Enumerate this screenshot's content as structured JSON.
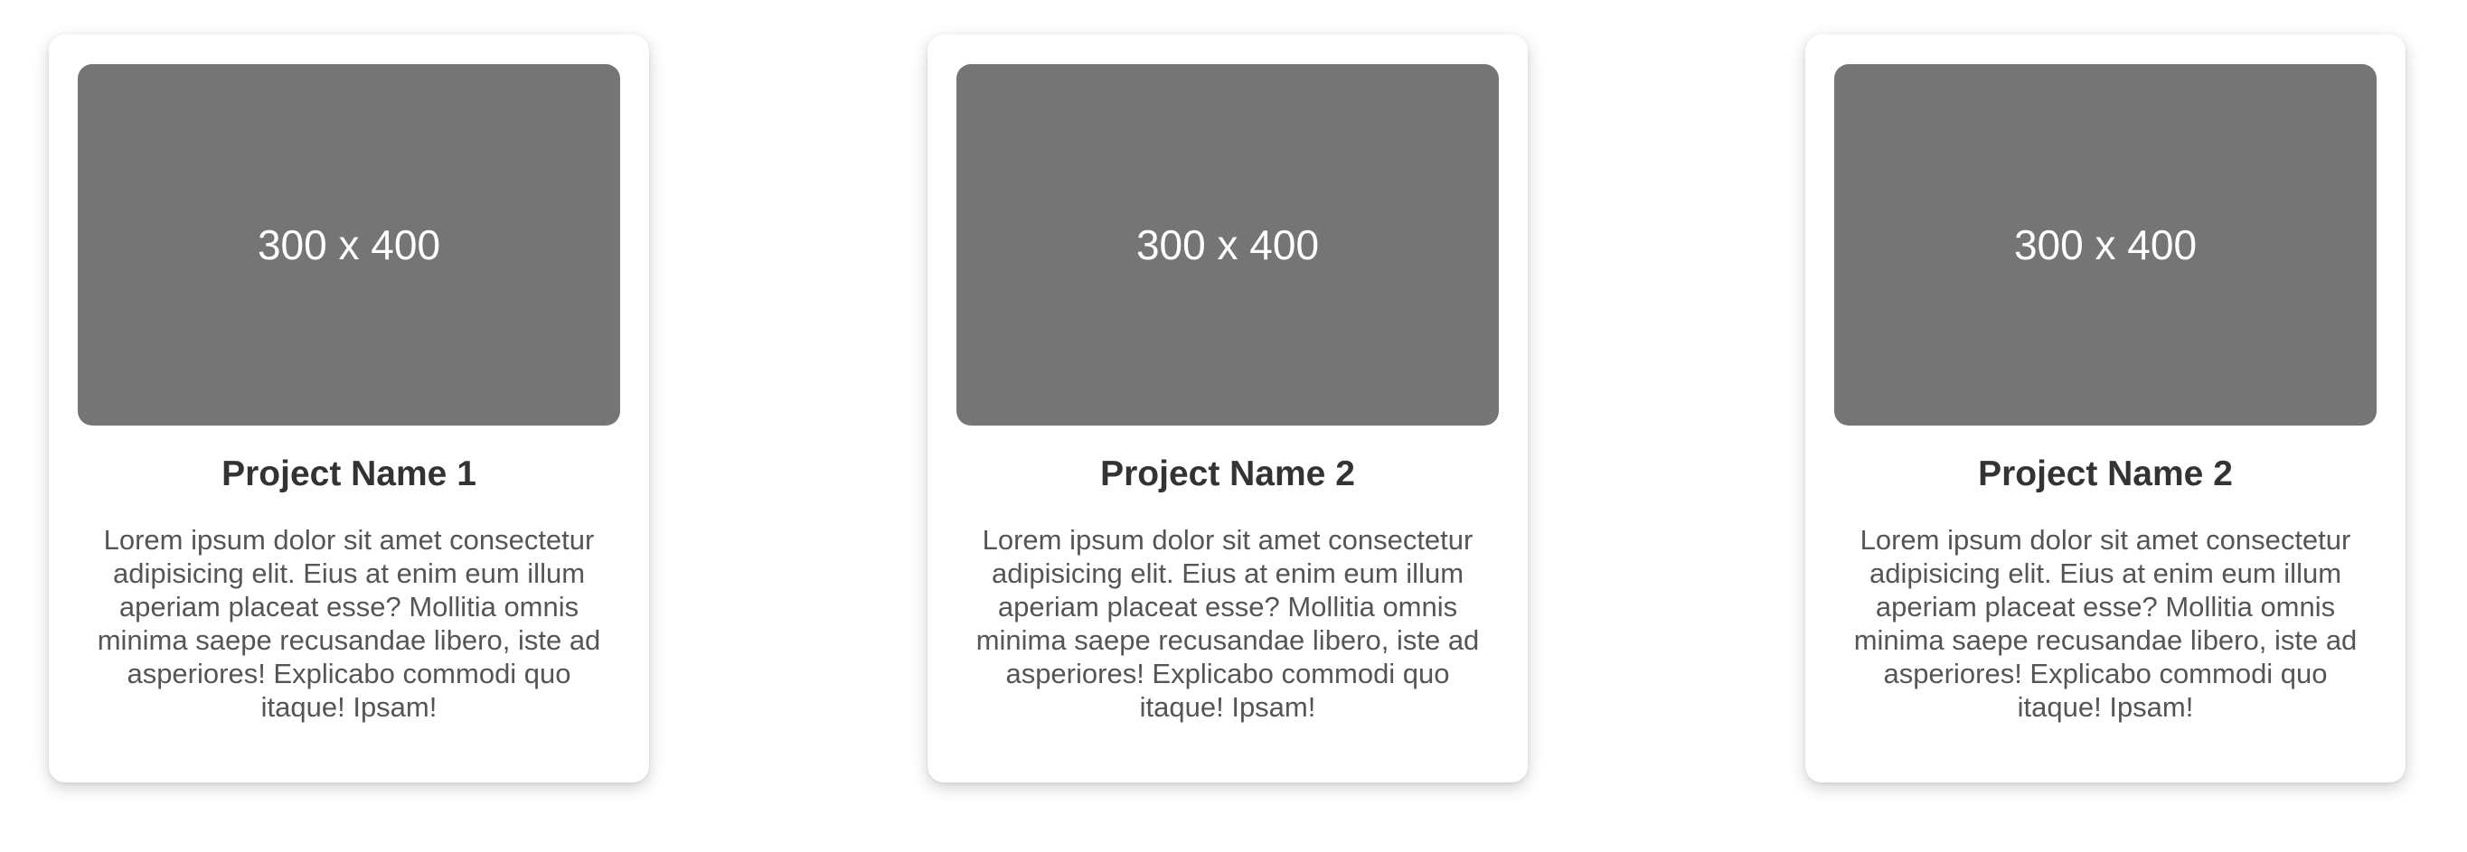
{
  "cards": [
    {
      "image_label": "300 x 400",
      "title": "Project Name 1",
      "description": "Lorem ipsum dolor sit amet consectetur adipisicing elit. Eius at enim eum illum aperiam placeat esse? Mollitia omnis minima saepe recusandae libero, iste ad asperiores! Explicabo commodi quo itaque! Ipsam!"
    },
    {
      "image_label": "300 x 400",
      "title": "Project Name 2",
      "description": "Lorem ipsum dolor sit amet consectetur adipisicing elit. Eius at enim eum illum aperiam placeat esse? Mollitia omnis minima saepe recusandae libero, iste ad asperiores! Explicabo commodi quo itaque! Ipsam!"
    },
    {
      "image_label": "300 x 400",
      "title": "Project Name 2",
      "description": "Lorem ipsum dolor sit amet consectetur adipisicing elit. Eius at enim eum illum aperiam placeat esse? Mollitia omnis minima saepe recusandae libero, iste ad asperiores! Explicabo commodi quo itaque! Ipsam!"
    }
  ],
  "colors": {
    "placeholder_bg": "#757575",
    "placeholder_text": "#ffffff",
    "title_text": "#333333",
    "body_text": "#555555",
    "card_bg": "#ffffff"
  }
}
